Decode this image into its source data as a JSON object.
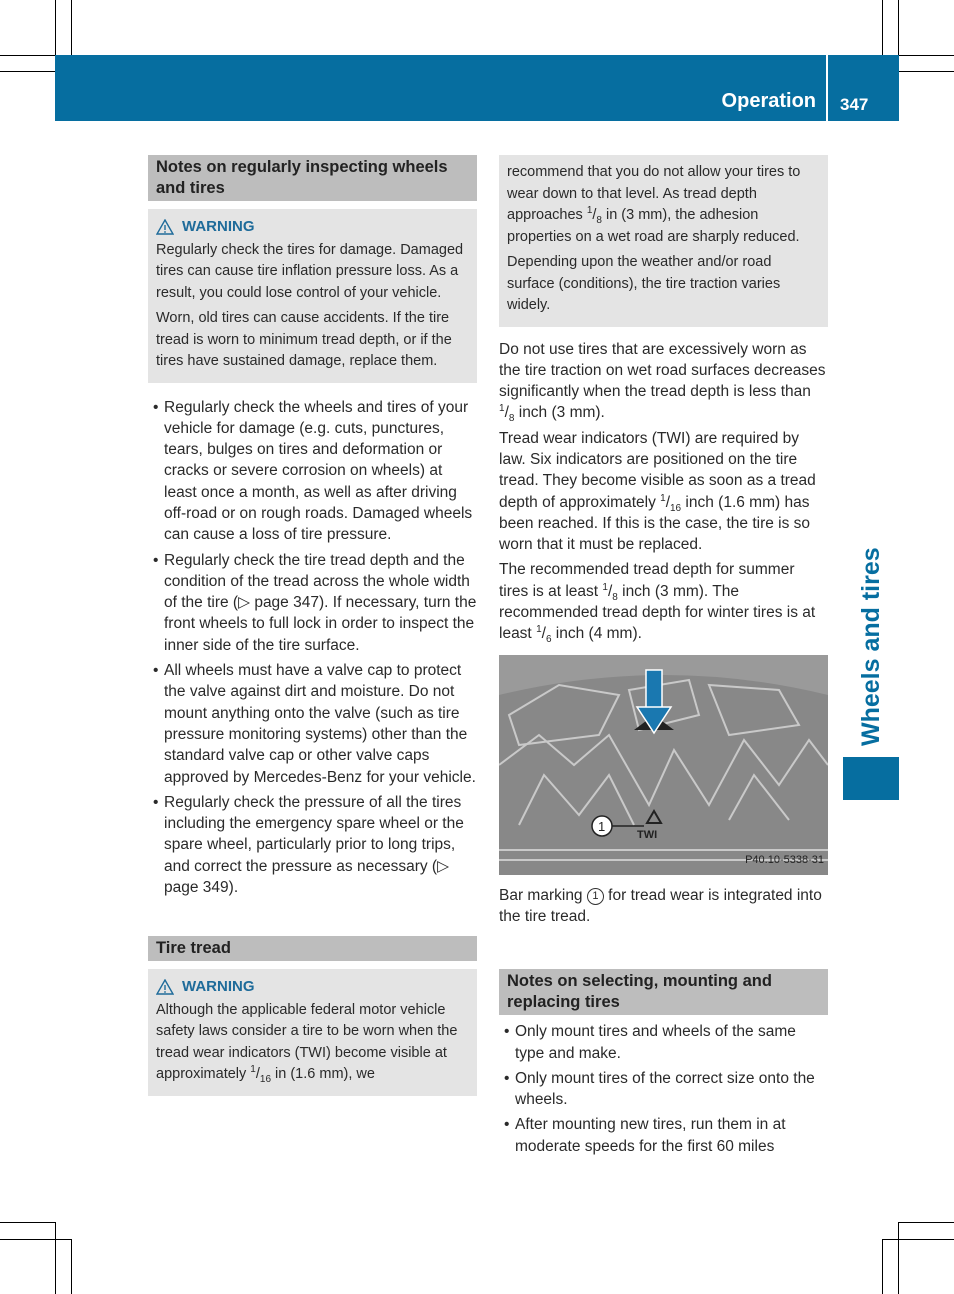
{
  "header": {
    "section": "Operation",
    "page_number": "347",
    "accent_color": "#066ea0"
  },
  "side_tab": {
    "label": "Wheels and tires"
  },
  "left_column": {
    "section1": {
      "heading": "Notes on regularly inspecting wheels and tires",
      "warning": {
        "icon": "warning-triangle-icon",
        "title": "WARNING",
        "paragraphs": [
          "Regularly check the tires for damage. Damaged tires can cause tire inflation pressure loss. As a result, you could lose control of your vehicle.",
          "Worn, old tires can cause accidents. If the tire tread is worn to minimum tread depth, or if the tires have sustained damage, replace them."
        ]
      },
      "bullets": [
        "Regularly check the wheels and tires of your vehicle for damage (e.g. cuts, punctures, tears, bulges on tires and deformation or cracks or severe corrosion on wheels) at least once a month, as well as after driving off-road or on rough roads. Damaged wheels can cause a loss of tire pressure.",
        {
          "before": "Regularly check the tire tread depth and the condition of the tread across the whole width of the tire (",
          "ref": "▷ page 347",
          "after": "). If necessary, turn the front wheels to full lock in order to inspect the inner side of the tire surface."
        },
        "All wheels must have a valve cap to protect the valve against dirt and moisture. Do not mount anything onto the valve (such as tire pressure monitoring systems) other than the standard valve cap or other valve caps approved by Mercedes-Benz for your vehicle.",
        {
          "before": "Regularly check the pressure of all the tires including the emergency spare wheel or the spare wheel, particularly prior to long trips, and correct the pressure as necessary (",
          "ref": "▷ page 349",
          "after": ")."
        }
      ]
    },
    "section2": {
      "heading": "Tire tread",
      "warning": {
        "title": "WARNING",
        "text_before": "Although the applicable federal motor vehicle safety laws consider a tire to be worn when the tread wear indicators (TWI) become visible at approximately ",
        "frac_num": "1",
        "frac_den": "16",
        "text_after": " in (1.6 mm), we"
      }
    }
  },
  "right_column": {
    "warning_cont": {
      "p1_before": "recommend that you do not allow your tires to wear down to that level. As tread depth approaches ",
      "p1_num": "1",
      "p1_den": "8",
      "p1_after": " in (3 mm), the adhesion properties on a wet road are sharply reduced.",
      "p2": "Depending upon the weather and/or road surface (conditions), the tire traction varies widely."
    },
    "paragraphs": {
      "p1_before": "Do not use tires that are excessively worn as the tire traction on wet road surfaces decreases significantly when the tread depth is less than ",
      "p1_num": "1",
      "p1_den": "8",
      "p1_after": " inch (3 mm).",
      "p2_before": "Tread wear indicators (TWI) are required by law. Six indicators are positioned on the tire tread. They become visible as soon as a tread depth of approximately ",
      "p2_num": "1",
      "p2_den": "16",
      "p2_after": " inch (1.6 mm) has been reached. If this is the case, the tire is so worn that it must be replaced.",
      "p3_before": "The recommended tread depth for summer tires is at least ",
      "p3_num": "1",
      "p3_den": "8",
      "p3_mid": " inch (3 mm). The recommended tread depth for winter tires is at least ",
      "p3_num2": "1",
      "p3_den2": "6",
      "p3_after": " inch (4 mm)."
    },
    "figure": {
      "callout": "1",
      "twi_label": "TWI",
      "code": "P40.10-5338-31"
    },
    "caption": {
      "before": "Bar marking ",
      "callout": "1",
      "after": " for tread wear is integrated into the tire tread."
    },
    "section3": {
      "heading": "Notes on selecting, mounting and replacing tires",
      "bullets": [
        "Only mount tires and wheels of the same type and make.",
        "Only mount tires of the correct size onto the wheels.",
        "After mounting new tires, run them in at moderate speeds for the first 60 miles"
      ]
    }
  }
}
